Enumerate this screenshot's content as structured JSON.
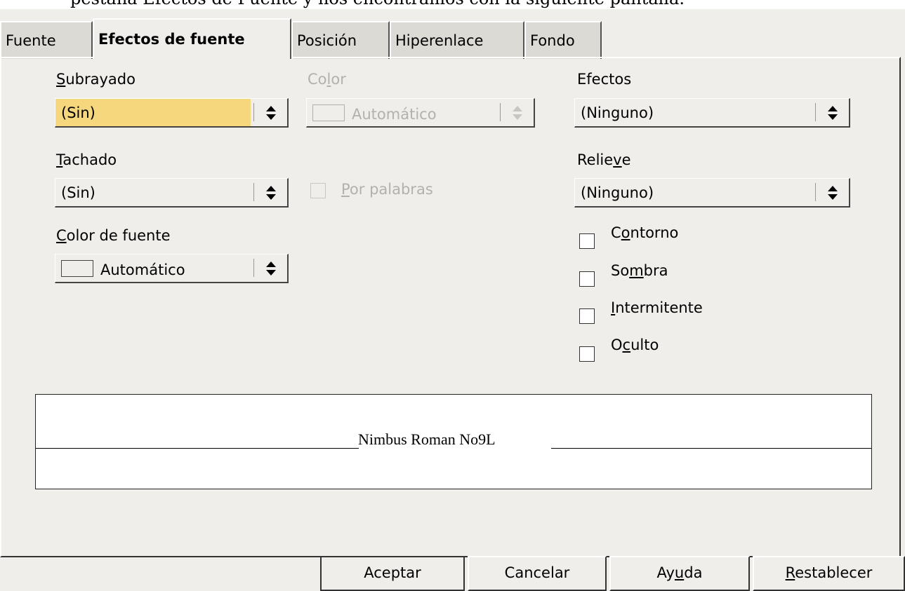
{
  "doc_text": "pestaña Efectos de Fuente y nos encontramos con la siguiente pantalla.",
  "tabs": [
    "Fuente",
    "Efectos de fuente",
    "Posición",
    "Hiperenlace",
    "Fondo"
  ],
  "underline": {
    "label": "Subrayado",
    "value": "(Sin)"
  },
  "color": {
    "label": "Color",
    "value": "Automático"
  },
  "effects": {
    "label": "Efectos",
    "value": "(Ninguno)"
  },
  "strike": {
    "label": "Tachado",
    "value": "(Sin)"
  },
  "by_words": {
    "label": "Por palabras"
  },
  "relief": {
    "label": "Relieve",
    "value": "(Ninguno)"
  },
  "font_color": {
    "label": "Color de fuente",
    "value": "Automático"
  },
  "checkboxes": [
    "Contorno",
    "Sombra",
    "Intermitente",
    "Oculto"
  ],
  "preview_text": "Nimbus Roman No9L",
  "buttons": [
    "Aceptar",
    "Cancelar",
    "Ayuda",
    "Restablecer"
  ],
  "colors": {
    "focus": "#f6d77e",
    "dialog_bg": "#efeeeb"
  }
}
